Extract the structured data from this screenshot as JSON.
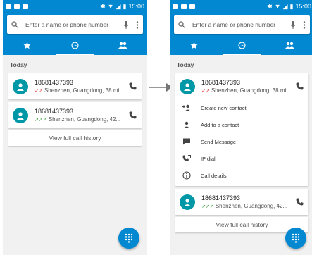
{
  "status": {
    "time": "15:00"
  },
  "search": {
    "placeholder": "Enter a name or phone number"
  },
  "tabs": [
    {
      "icon": "star-icon"
    },
    {
      "icon": "clock-icon",
      "active": true
    },
    {
      "icon": "people-icon"
    }
  ],
  "section_label": "Today",
  "calls": [
    {
      "number": "18681437393",
      "detail": "Shenzhen, Guangdong, 38 mi...",
      "type": "missed"
    },
    {
      "number": "18681437393",
      "detail": "Shenzhen, Guangdong, 42...",
      "type": "outgoing"
    }
  ],
  "history_label": "View full call history",
  "expanded_menu": [
    {
      "label": "Create new contact",
      "icon": "add-person-icon"
    },
    {
      "label": "Add to a contact",
      "icon": "person-icon"
    },
    {
      "label": "Send Message",
      "icon": "message-icon"
    },
    {
      "label": "IP dial",
      "icon": "ip-dial-icon"
    },
    {
      "label": "Call details",
      "icon": "info-icon"
    }
  ],
  "colors": {
    "primary": "#0288d1",
    "avatar": "#0097a7",
    "missed": "#e53935",
    "outgoing": "#43a047"
  }
}
